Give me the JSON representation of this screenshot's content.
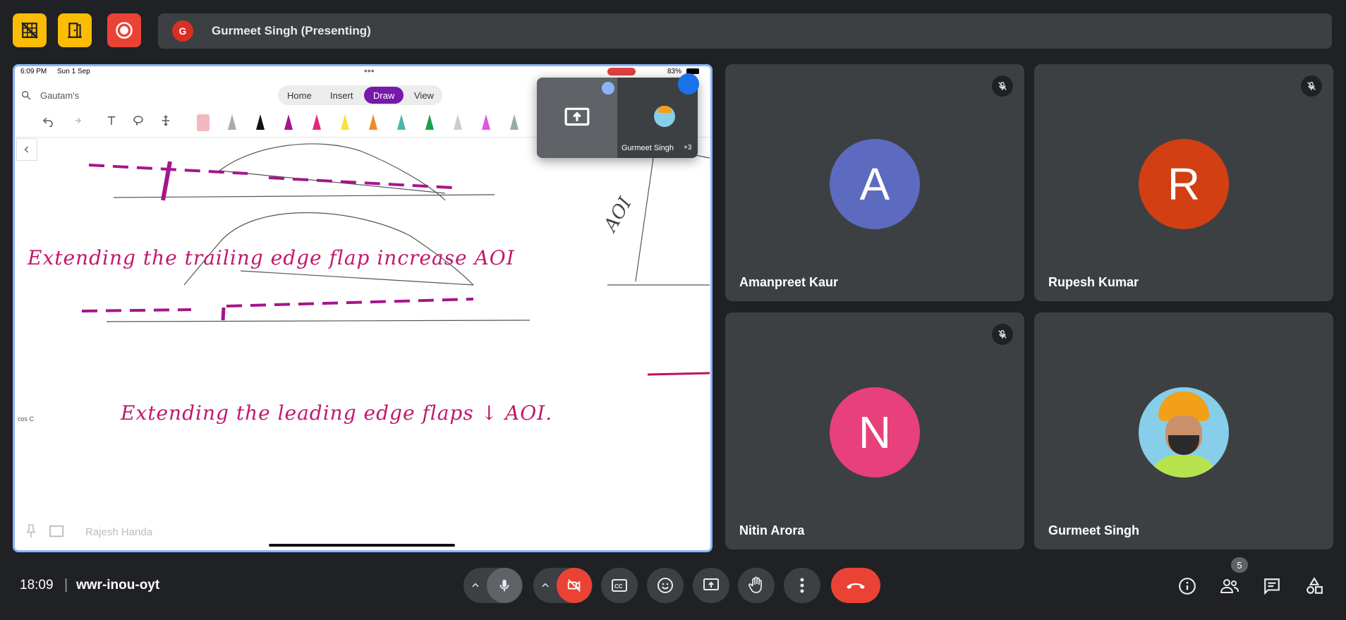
{
  "colors": {
    "accent": "#8ab4f8",
    "end_call": "#ea4335",
    "yellow": "#fbbc04",
    "tile_bg": "#3c4043"
  },
  "top_bar": {
    "presenter_initial": "G",
    "presenter_label": "Gurmeet Singh (Presenting)",
    "icons": [
      "no-grid-icon",
      "door-exit-icon",
      "record-icon"
    ]
  },
  "screen": {
    "status_time": "6:09 PM",
    "status_date": "Sun 1 Sep",
    "battery": "83%",
    "search_text": "Gautam's",
    "tabs": [
      "Home",
      "Insert",
      "Draw",
      "View"
    ],
    "active_tab": "Draw",
    "pip_name": "Gurmeet Singh",
    "pip_extra": "+3",
    "footer_name": "Rajesh Handa",
    "note_line1": "Extending the trailing edge flap increase AOI",
    "note_line2": "Extending the leading edge flaps ↓ AOI.",
    "note_side": "AOI",
    "note_small": "cos C"
  },
  "participants": [
    {
      "name": "Amanpreet Kaur",
      "initial": "A",
      "color": "#5c6bc0",
      "muted": true
    },
    {
      "name": "Rupesh Kumar",
      "initial": "R",
      "color": "#d23f12",
      "muted": true
    },
    {
      "name": "Nitin Arora",
      "initial": "N",
      "color": "#e8407a",
      "muted": true
    },
    {
      "name": "Gurmeet Singh",
      "initial": "",
      "color": "#87ceeb",
      "muted": false
    }
  ],
  "bottom": {
    "time": "18:09",
    "separator": "|",
    "meeting_code": "wwr-inou-oyt",
    "participant_count": "5"
  }
}
